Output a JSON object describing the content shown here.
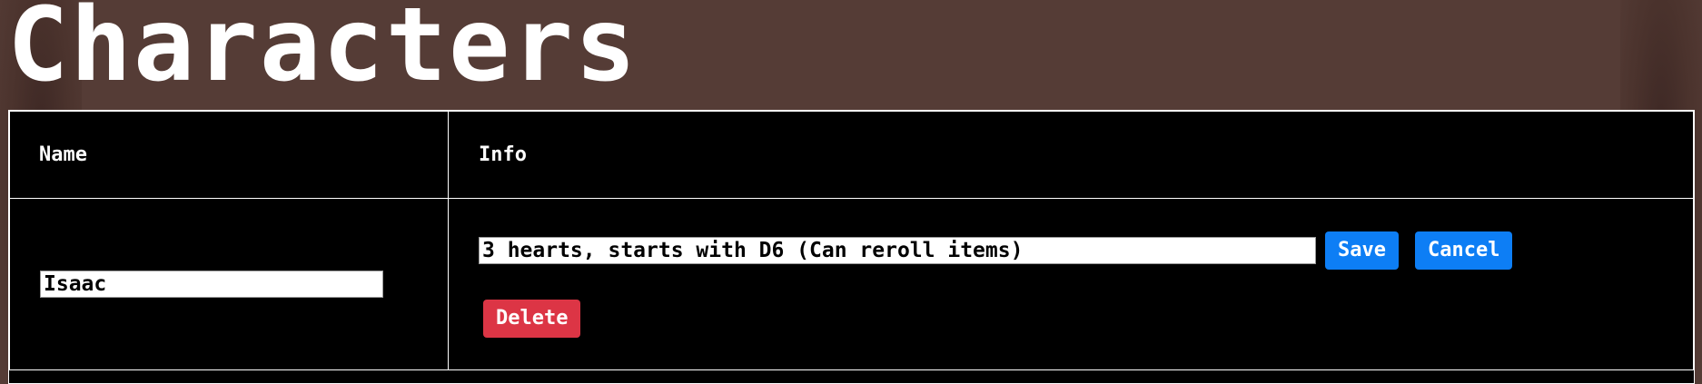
{
  "page": {
    "title": "Characters"
  },
  "table": {
    "headers": {
      "name": "Name",
      "info": "Info"
    },
    "rows": [
      {
        "name_value": "Isaac",
        "info_value": "3 hearts, starts with D6 (Can reroll items)",
        "save_label": "Save",
        "cancel_label": "Cancel",
        "delete_label": "Delete"
      }
    ]
  },
  "colors": {
    "background": "#553c36",
    "table_bg": "#000000",
    "primary_button": "#0d7ef5",
    "danger_button": "#dc3545",
    "text": "#ffffff"
  }
}
